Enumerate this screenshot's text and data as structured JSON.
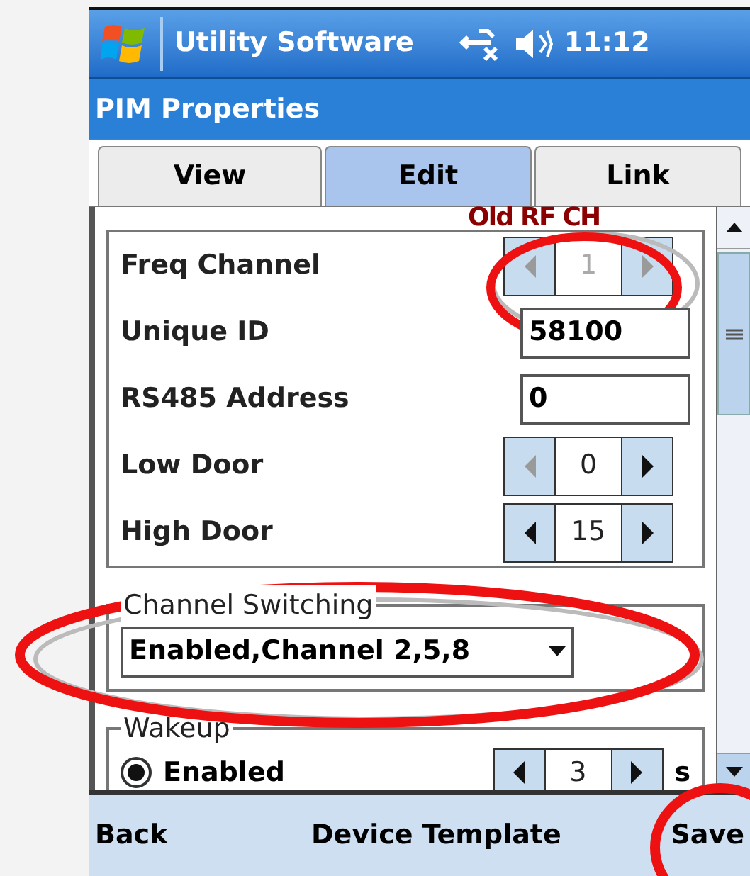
{
  "status_bar": {
    "title": "Utility Software",
    "time": "11:12"
  },
  "window": {
    "title": "PIM Properties"
  },
  "tabs": [
    {
      "label": "View",
      "selected": false
    },
    {
      "label": "Edit",
      "selected": true
    },
    {
      "label": "Link",
      "selected": false
    }
  ],
  "fields": [
    {
      "kind": "spinner",
      "label": "Freq Channel",
      "value": "1",
      "disabled": true,
      "decrement_enabled": false,
      "increment_enabled": false
    },
    {
      "kind": "text",
      "label": "Unique ID",
      "value": "58100"
    },
    {
      "kind": "text",
      "label": "RS485 Address",
      "value": "0"
    },
    {
      "kind": "spinner",
      "label": "Low Door",
      "value": "0",
      "disabled": false,
      "decrement_enabled": false,
      "increment_enabled": true
    },
    {
      "kind": "spinner",
      "label": "High Door",
      "value": "15",
      "disabled": false,
      "decrement_enabled": true,
      "increment_enabled": true
    }
  ],
  "channel_switching": {
    "legend": "Channel Switching",
    "value": "Enabled,Channel 2,5,8"
  },
  "wakeup": {
    "legend": "Wakeup",
    "radio": {
      "label": "Enabled",
      "selected": true
    },
    "spinner": {
      "value": "3",
      "decrement_enabled": true,
      "increment_enabled": true
    },
    "unit": "s"
  },
  "menu_bar": {
    "left": "Back",
    "center": "Device Template",
    "right": "Save"
  },
  "annotation": {
    "text": "Old RF CH"
  }
}
